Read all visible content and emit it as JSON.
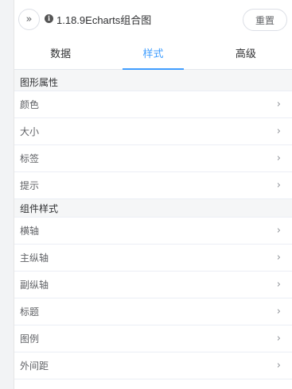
{
  "header": {
    "collapse_icon": "»",
    "info_icon": "i",
    "title": "1.18.9Echarts组合图",
    "reset_label": "重置"
  },
  "tabs": [
    {
      "label": "数据",
      "active": false
    },
    {
      "label": "样式",
      "active": true
    },
    {
      "label": "高级",
      "active": false
    }
  ],
  "sections": [
    {
      "title": "图形属性",
      "items": [
        "颜色",
        "大小",
        "标签",
        "提示"
      ]
    },
    {
      "title": "组件样式",
      "items": [
        "横轴",
        "主纵轴",
        "副纵轴",
        "标题",
        "图例",
        "外间距"
      ]
    }
  ],
  "colors": {
    "accent": "#409eff",
    "text": "#303133",
    "muted": "#606266"
  }
}
